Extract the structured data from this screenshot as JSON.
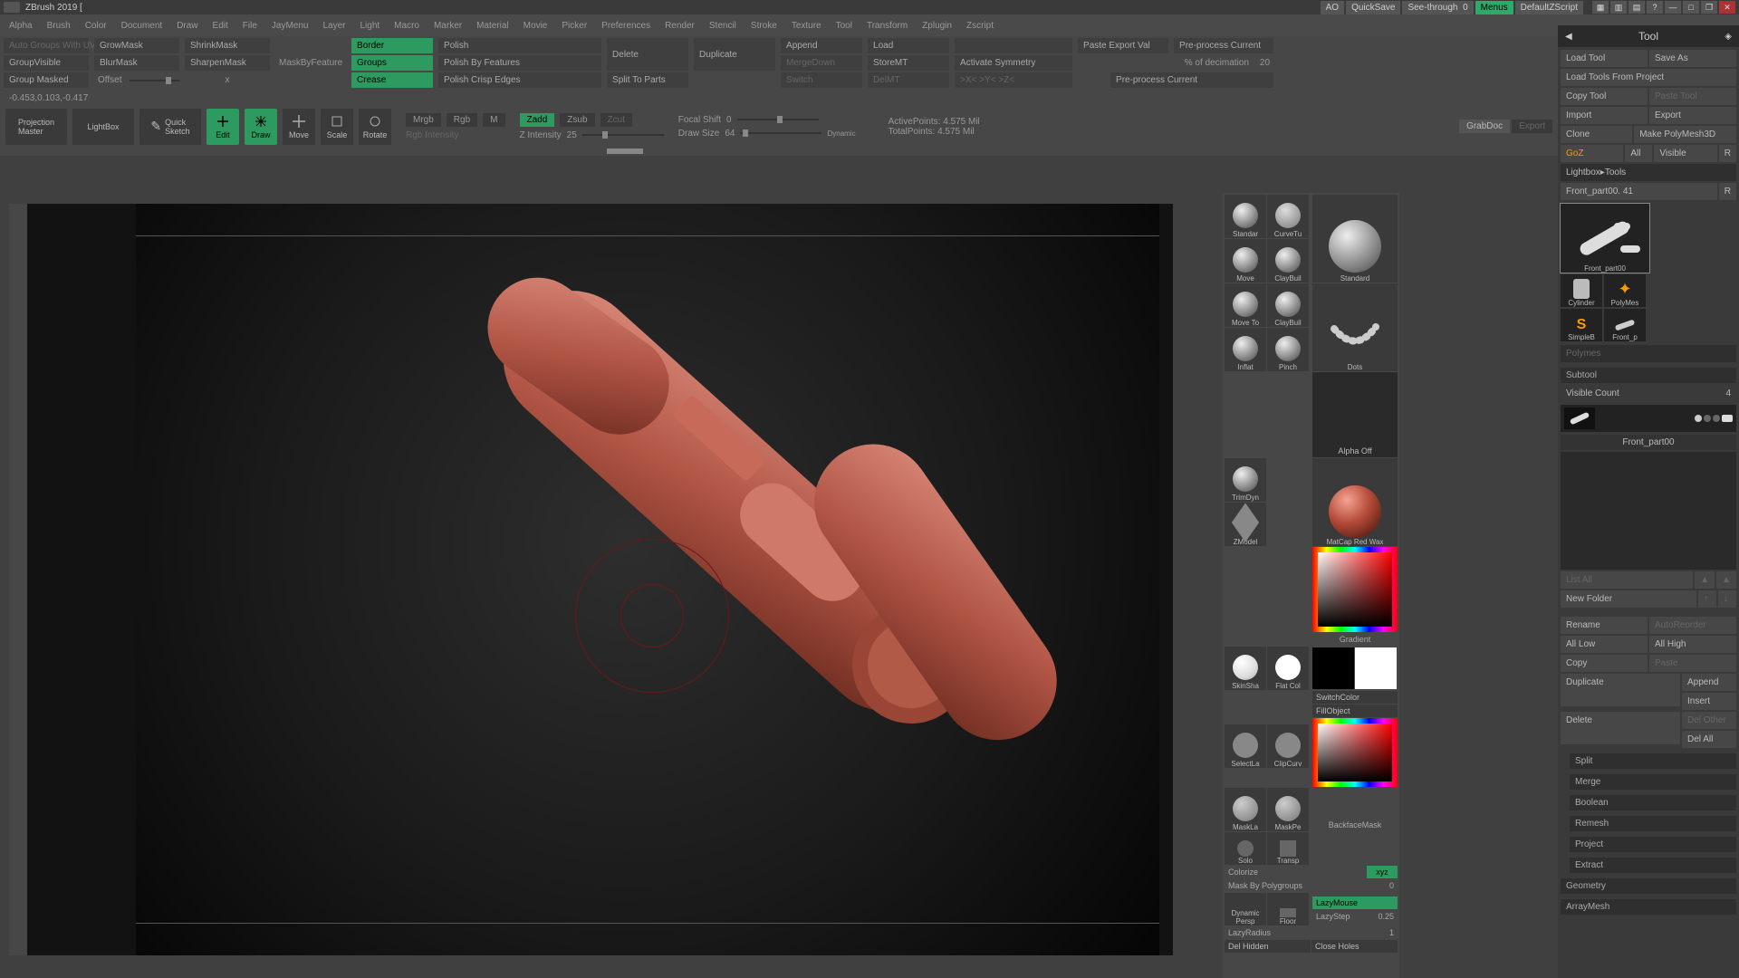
{
  "title": "ZBrush 2019 [",
  "topUtil": {
    "ao": "AO",
    "quicksave": "QuickSave",
    "seethrough_label": "See-through",
    "seethrough_val": "0",
    "menus": "Menus",
    "zscript": "DefaultZScript"
  },
  "menu": [
    "Alpha",
    "Brush",
    "Color",
    "Document",
    "Draw",
    "Edit",
    "File",
    "JayMenu",
    "Layer",
    "Light",
    "Macro",
    "Marker",
    "Material",
    "Movie",
    "Picker",
    "Preferences",
    "Render",
    "Stencil",
    "Stroke",
    "Texture",
    "Tool",
    "Transform",
    "Zplugin",
    "Zscript"
  ],
  "shelf": {
    "col1": {
      "autogroups": "Auto Groups With UV",
      "groupvisible": "GroupVisible",
      "groupmasked": "Group Masked"
    },
    "col2": {
      "growmask": "GrowMask",
      "blurmask": "BlurMask",
      "offset": "Offset"
    },
    "col3": {
      "shrinkmask": "ShrinkMask",
      "sharpenmask": "SharpenMask",
      "x": "x"
    },
    "maskby_label": "MaskByFeature",
    "maskby": {
      "border": "Border",
      "groups": "Groups",
      "crease": "Crease"
    },
    "polish": {
      "polish": "Polish",
      "polishbyfeatures": "Polish By Features",
      "polishcrisp": "Polish Crisp Edges"
    },
    "col_de": {
      "delete": "Delete",
      "split": "Split To Parts"
    },
    "col_dup": {
      "duplicate": "Duplicate"
    },
    "col_app": {
      "append": "Append",
      "mergedown": "MergeDown",
      "switch": "Switch"
    },
    "col_load": {
      "load": "Load",
      "storemt": "StoreMT",
      "delmt": "DelMT"
    },
    "col_sym": {
      "empty": "",
      "activate": "Activate Symmetry",
      "xyz": ">X<       >Y<       >Z<"
    },
    "col_exp": {
      "paste": "Paste Export Val",
      "preproccur": "Pre-process Current",
      "decimation_lbl": "% of decimation",
      "decimation_val": "20",
      "preproc2": "Pre-process Current"
    }
  },
  "coord": "-0.453,0.103,-0.417",
  "toolrow": {
    "projmaster": "Projection\nMaster",
    "lightbox": "LightBox",
    "quicksketch": "Quick\nSketch",
    "edit": "Edit",
    "draw": "Draw",
    "move": "Move",
    "scale": "Scale",
    "rotate": "Rotate",
    "mrgb": "Mrgb",
    "rgb": "Rgb",
    "m": "M",
    "rgbintensity": "Rgb Intensity",
    "zadd": "Zadd",
    "zsub": "Zsub",
    "zcut": "Zcut",
    "zintensity_lbl": "Z Intensity",
    "zintensity_val": "25",
    "focal_lbl": "Focal Shift",
    "focal_val": "0",
    "drawsize_lbl": "Draw Size",
    "drawsize_val": "64",
    "dynamic": "Dynamic",
    "active_lbl": "ActivePoints:",
    "active_val": "4.575 Mil",
    "total_lbl": "TotalPoints:",
    "total_val": "4.575 Mil",
    "grabdoc": "GrabDoc",
    "export": "Export"
  },
  "brushes": {
    "row1": [
      "Standar",
      "CurveTu"
    ],
    "big": "Standard",
    "row2": [
      "Move",
      "ClayBuil"
    ],
    "row3": [
      "Move To",
      "ClayBuil"
    ],
    "row4": [
      "Inflat",
      "Pinch"
    ],
    "dots": "Dots",
    "alphaoff": "Alpha Off",
    "trimdyn": "TrimDyn",
    "zmodel": "ZModel",
    "matcap": "MatCap Red Wax",
    "gradient": "Gradient",
    "skinsha": "SkinSha",
    "flatcol": "Flat Col",
    "switchcolor": "SwitchColor",
    "fillobject": "FillObject",
    "selectla": "SelectLa",
    "clipcurv": "ClipCurv",
    "maskla": "MaskLa",
    "maskpe": "MaskPe",
    "backface": "BackfaceMask",
    "solo": "Solo",
    "transp": "Transp",
    "colorize": "Colorize",
    "xyz": "xyz",
    "maskbypg": "Mask By Polygroups",
    "maskbypg_val": "0",
    "dynamic": "Dynamic",
    "persp": "Persp",
    "floor": "Floor",
    "lazymouse": "LazyMouse",
    "lazystep_lbl": "LazyStep",
    "lazystep_val": "0.25",
    "lazyradius_lbl": "LazyRadius",
    "lazyradius_val": "1",
    "delhidden": "Del Hidden",
    "closeholes": "Close Holes"
  },
  "tool": {
    "title": "Tool",
    "loadtool": "Load Tool",
    "saveas": "Save As",
    "loadfromproject": "Load Tools From Project",
    "copytool": "Copy Tool",
    "pastetool": "Paste Tool",
    "import": "Import",
    "export": "Export",
    "clone": "Clone",
    "makepolymesh": "Make PolyMesh3D",
    "goz": "GoZ",
    "all": "All",
    "visible": "Visible",
    "r": "R",
    "lightbox": "Lightbox▸Tools",
    "toolname": "Front_part00. 41",
    "r2": "R",
    "thumbs": [
      "Front_part00",
      "Cylinder",
      "PolyMes",
      "SimpleB",
      "Front_p"
    ],
    "polymesh": "Polymes",
    "subtool_hdr": "Subtool",
    "visiblecount_lbl": "Visible Count",
    "visiblecount_val": "4",
    "subtool_name": "Front_part00",
    "listall": "List All",
    "newfolder": "New Folder",
    "rename": "Rename",
    "autoreorder": "AutoReorder",
    "alllow": "All Low",
    "allhigh": "All High",
    "copy": "Copy",
    "paste": "Paste",
    "duplicate": "Duplicate",
    "append": "Append",
    "insert": "Insert",
    "delete": "Delete",
    "delother": "Del Other",
    "delall": "Del All",
    "sections": [
      "Split",
      "Merge",
      "Boolean",
      "Remesh",
      "Project",
      "Extract"
    ],
    "geom": "Geometry",
    "arraymesh": "ArrayMesh"
  }
}
